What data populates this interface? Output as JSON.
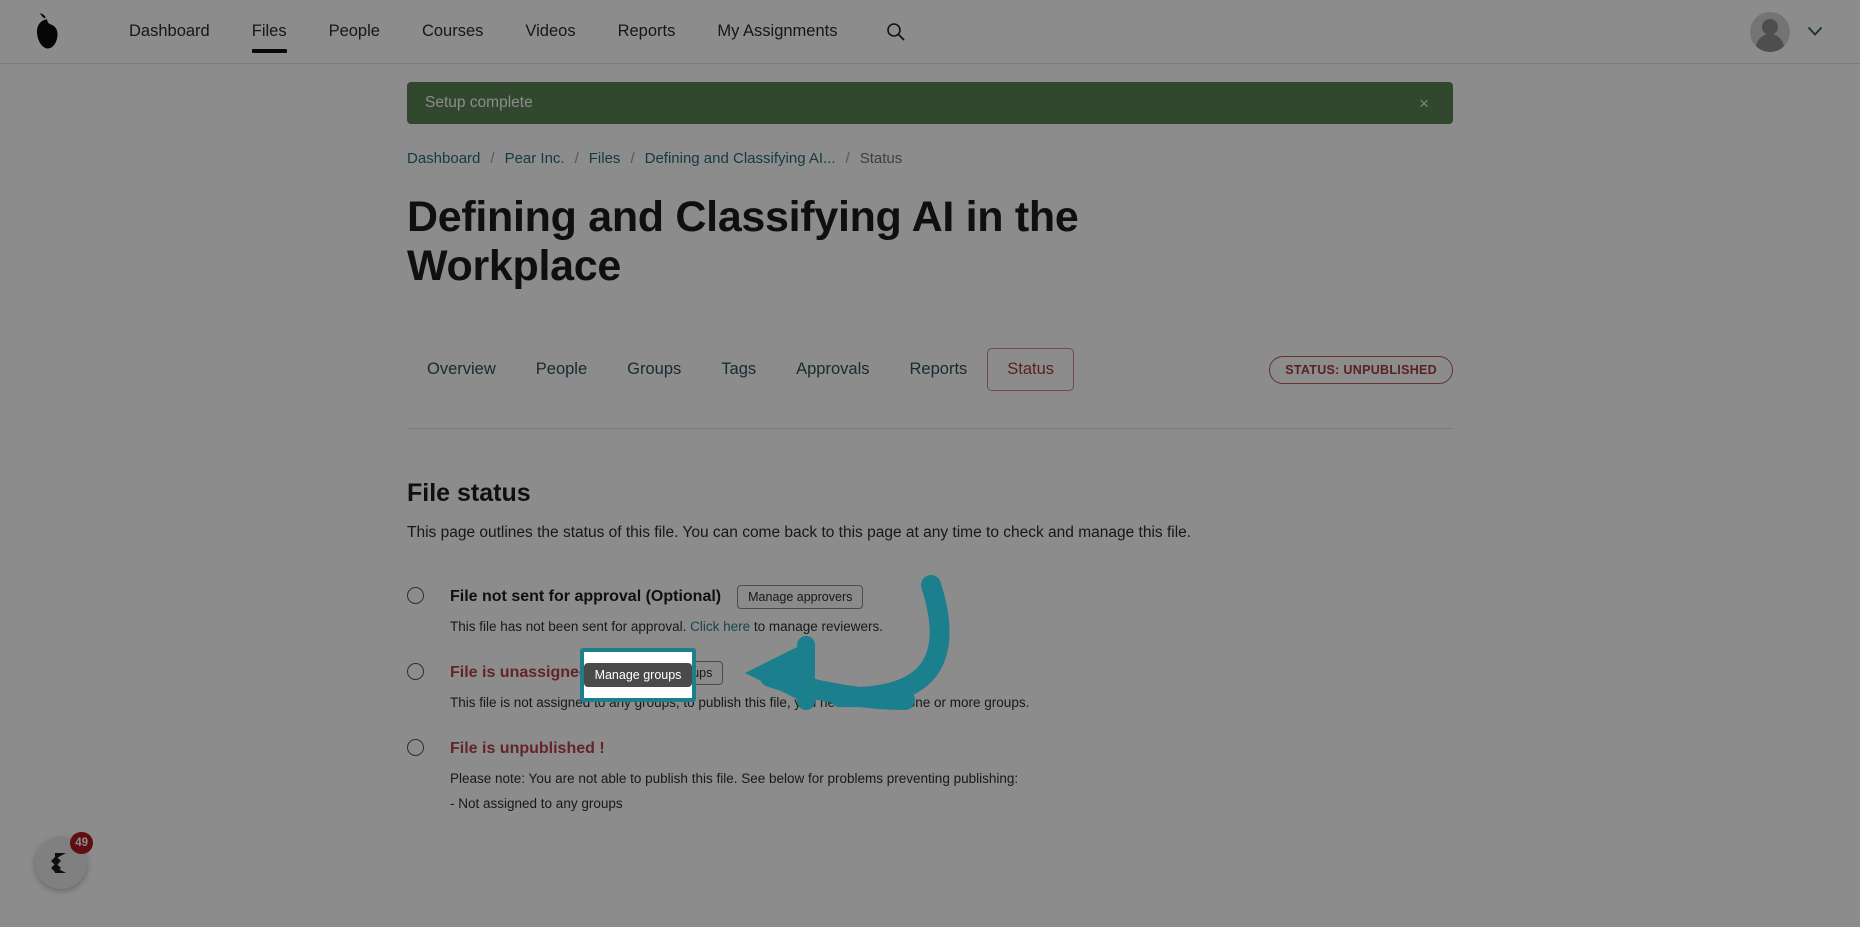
{
  "topnav": {
    "logo_icon": "pear-logo-icon",
    "links": [
      {
        "label": "Dashboard",
        "active": false
      },
      {
        "label": "Files",
        "active": true
      },
      {
        "label": "People",
        "active": false
      },
      {
        "label": "Courses",
        "active": false
      },
      {
        "label": "Videos",
        "active": false
      },
      {
        "label": "Reports",
        "active": false
      },
      {
        "label": "My Assignments",
        "active": false
      }
    ],
    "search_icon": "search-icon",
    "avatar_icon": "user-avatar-icon",
    "caret_icon": "chevron-down-icon"
  },
  "alert": {
    "message": "Setup complete",
    "close_label": "×",
    "color": "#5c8354"
  },
  "breadcrumb": {
    "items": [
      {
        "label": "Dashboard",
        "link": true
      },
      {
        "label": "Pear Inc.",
        "link": true
      },
      {
        "label": "Files",
        "link": true
      },
      {
        "label": "Defining and Classifying AI...",
        "link": true
      },
      {
        "label": "Status",
        "link": false
      }
    ],
    "separator": "/"
  },
  "page": {
    "title": "Defining and Classifying AI in the Workplace"
  },
  "tabs": {
    "items": [
      {
        "label": "Overview",
        "selected": false
      },
      {
        "label": "People",
        "selected": false
      },
      {
        "label": "Groups",
        "selected": false
      },
      {
        "label": "Tags",
        "selected": false
      },
      {
        "label": "Approvals",
        "selected": false
      },
      {
        "label": "Reports",
        "selected": false
      },
      {
        "label": "Status",
        "selected": true
      }
    ],
    "status_badge": "STATUS: UNPUBLISHED",
    "status_badge_color": "#a33c3c"
  },
  "file_status": {
    "heading": "File status",
    "description": "This page outlines the status of this file. You can come back to this page at any time to check and manage this file.",
    "items": [
      {
        "label": "File not sent for approval (Optional)",
        "warn": false,
        "button": "Manage approvers",
        "sub_pre": "This file has not been sent for approval. ",
        "sub_link": "Click here",
        "sub_post": " to manage reviewers.",
        "sub_line2": ""
      },
      {
        "label": "File is unassigned !",
        "warn": true,
        "button": "Manage groups",
        "sub_pre": "This file is not assigned to any groups, to publish this file, you need to select one or more groups.",
        "sub_link": "",
        "sub_post": "",
        "sub_line2": ""
      },
      {
        "label": "File is unpublished !",
        "warn": true,
        "button": "",
        "sub_pre": "Please note: You are not able to publish this file. See below for problems preventing publishing:",
        "sub_link": "",
        "sub_post": "",
        "sub_line2": "- Not assigned to any groups"
      }
    ]
  },
  "chat_widget": {
    "icon": "chat-bubble-icon",
    "badge_count": "49",
    "badge_color": "#b01b24"
  },
  "annotation": {
    "tooltip_label": "Manage groups",
    "highlight_color": "#1b7f8e",
    "arrow_color": "#1b7f8e",
    "arrow_icon": "curved-arrow-pointing-left-icon"
  }
}
